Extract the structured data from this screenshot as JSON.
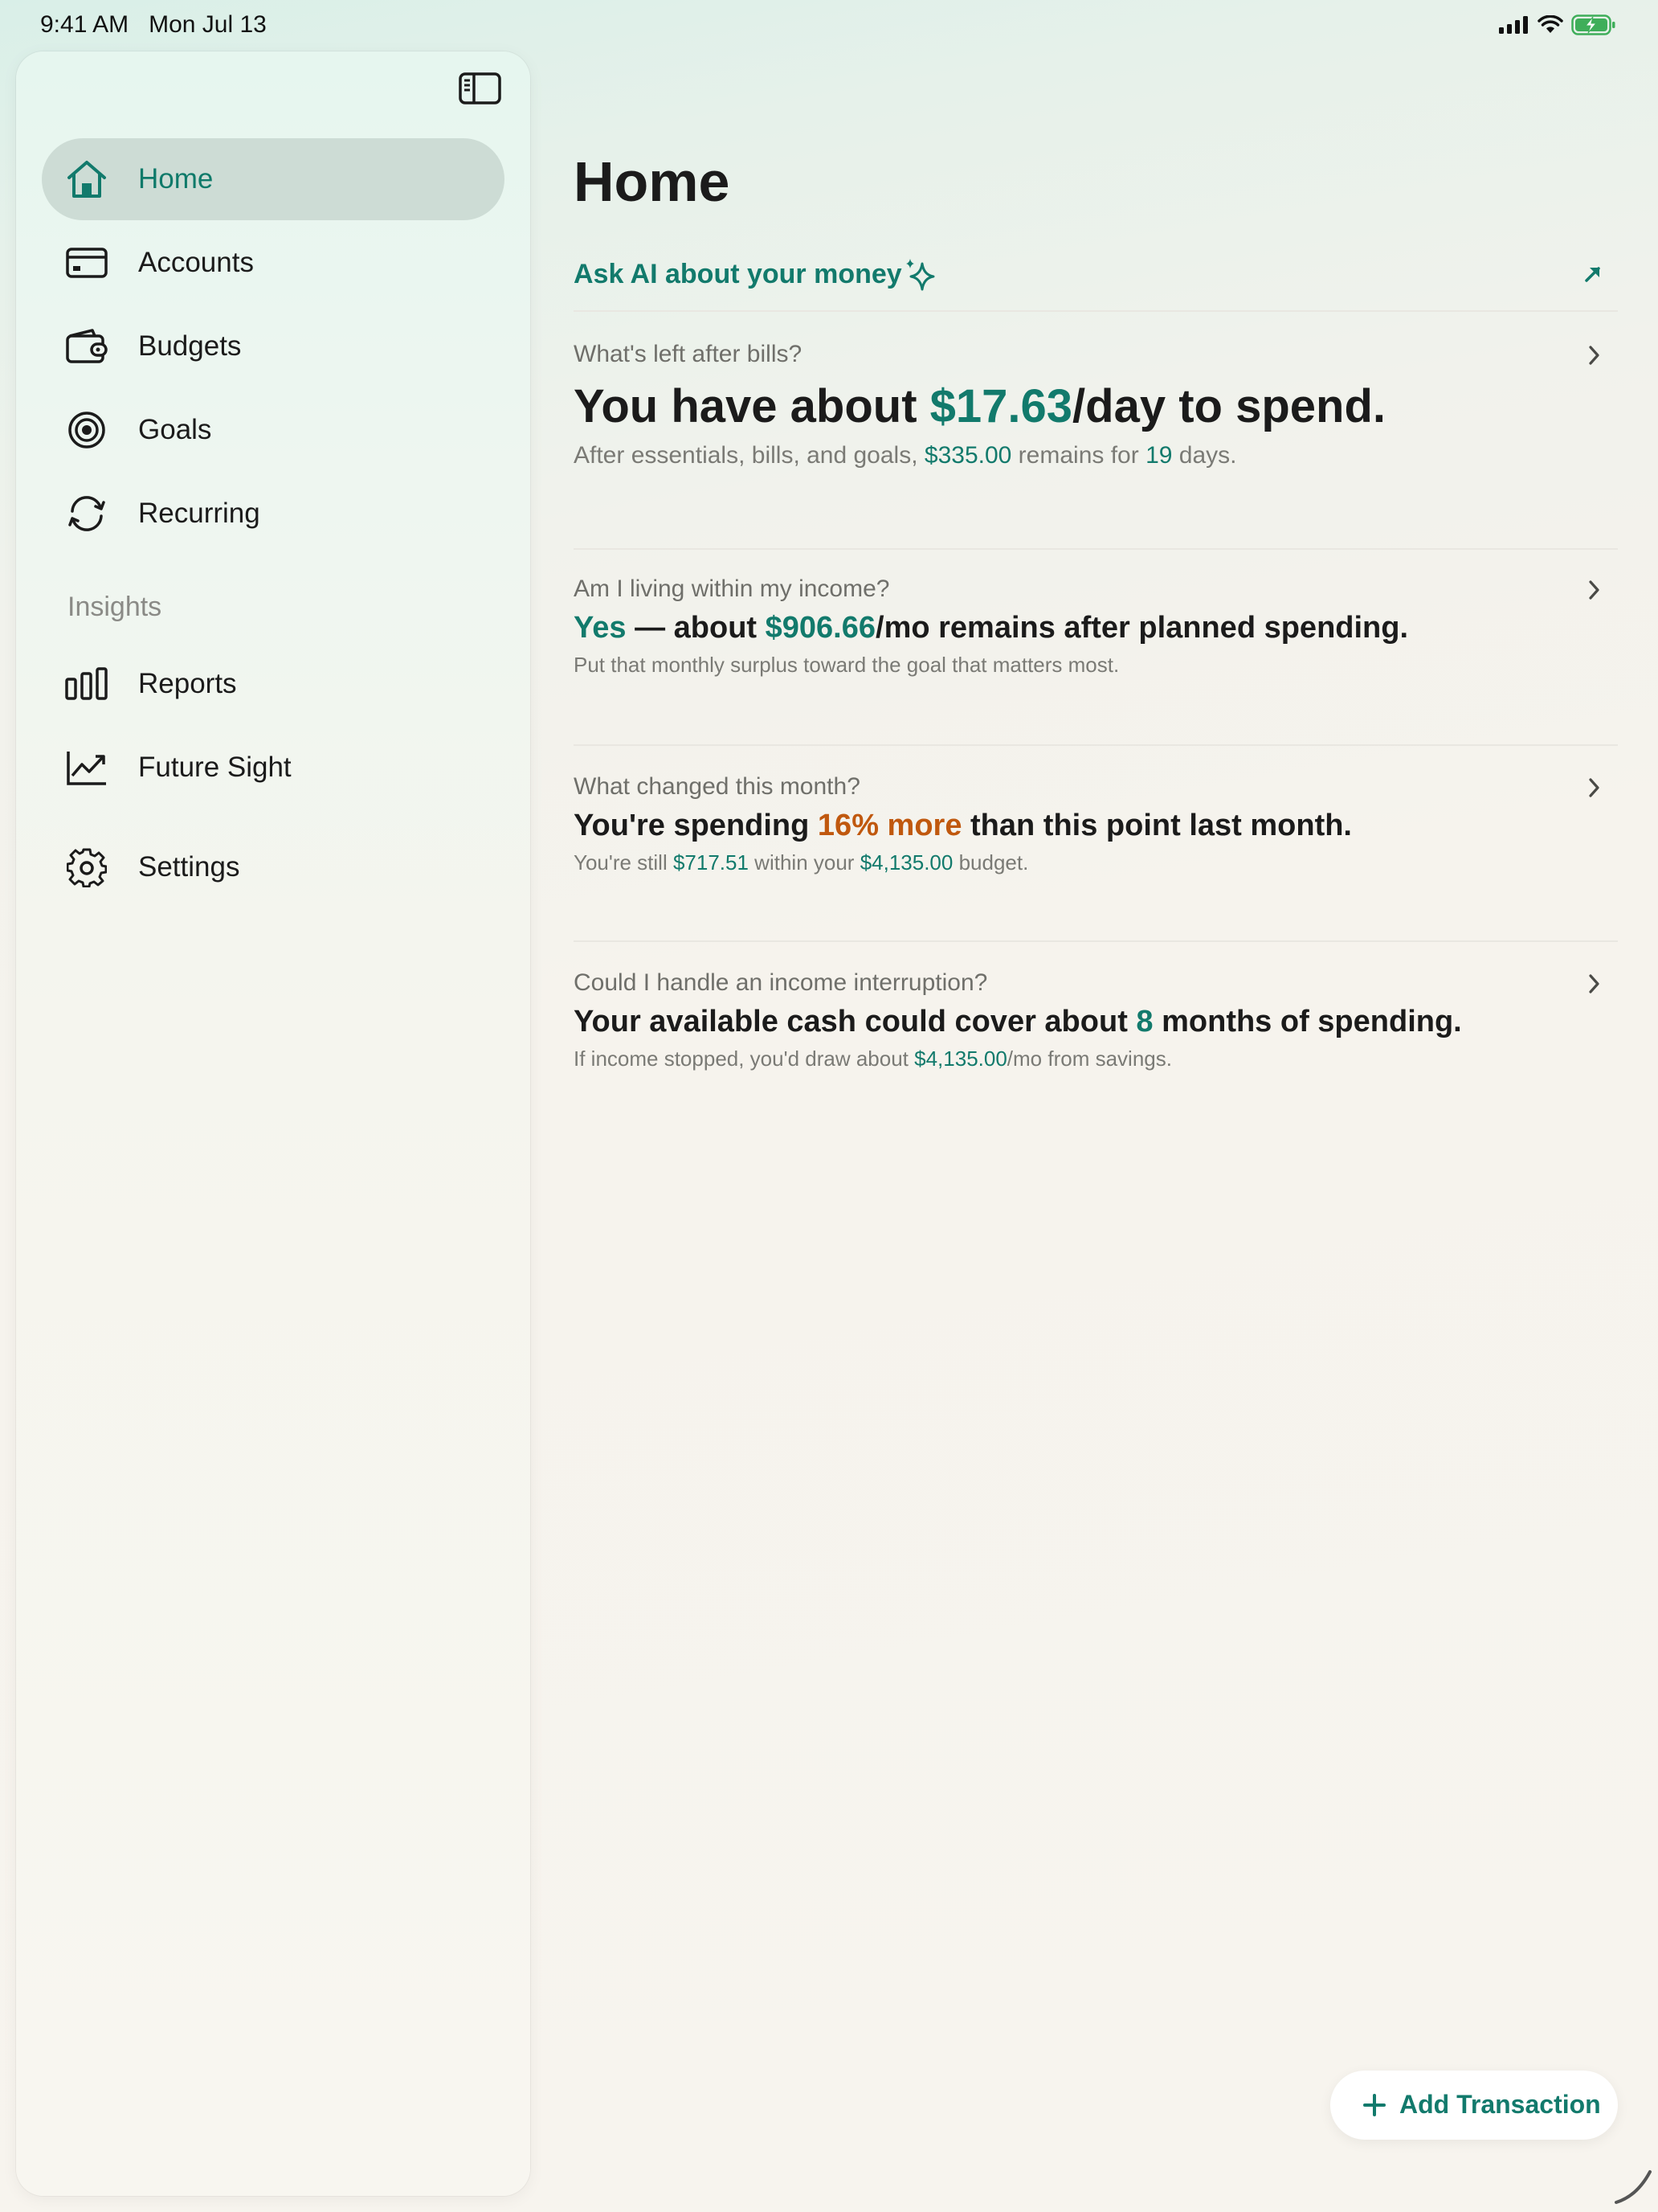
{
  "status_bar": {
    "time": "9:41 AM",
    "date": "Mon Jul 13"
  },
  "sidebar": {
    "items": [
      {
        "label": "Home",
        "icon": "home-icon",
        "active": true
      },
      {
        "label": "Accounts",
        "icon": "credit-card-icon"
      },
      {
        "label": "Budgets",
        "icon": "wallet-icon"
      },
      {
        "label": "Goals",
        "icon": "target-icon"
      },
      {
        "label": "Recurring",
        "icon": "recurring-icon"
      }
    ],
    "section_label": "Insights",
    "insights_items": [
      {
        "label": "Reports",
        "icon": "bar-chart-icon"
      },
      {
        "label": "Future Sight",
        "icon": "trend-chart-icon"
      }
    ],
    "settings_label": "Settings"
  },
  "main": {
    "title": "Home",
    "ai_prompt": "Ask AI about your money",
    "cards": [
      {
        "question": "What's left after bills?",
        "headline": {
          "pre": "You have about ",
          "amount": "$17.63",
          "post": "/day to spend."
        },
        "sub": {
          "pre": "After essentials, bills, and goals, ",
          "amount": "$335.00",
          "mid": " remains for ",
          "days": "19",
          "post": " days."
        }
      },
      {
        "question": "Am I living within my income?",
        "headline": {
          "yes": "Yes",
          "pre": " — about ",
          "amount": "$906.66",
          "post": "/mo remains after planned spending."
        },
        "sub": "Put that monthly surplus toward the goal that matters most."
      },
      {
        "question": "What changed this month?",
        "headline": {
          "pre": "You're spending ",
          "highlight": "16% more",
          "post": " than this point last month."
        },
        "sub": {
          "pre": "You're still ",
          "amount1": "$717.51",
          "mid": " within your ",
          "amount2": "$4,135.00",
          "post": " budget."
        }
      },
      {
        "question": "Could I handle an income interruption?",
        "headline": {
          "pre": "Your available cash could cover about ",
          "months": "8",
          "post": " months of spending."
        },
        "sub": {
          "pre": "If income stopped, you'd draw about ",
          "amount": "$4,135.00",
          "post": "/mo from savings."
        }
      }
    ]
  },
  "add_transaction_label": "Add Transaction",
  "colors": {
    "accent": "#127a6c",
    "warning": "#c0580e",
    "active_nav_bg": "#cddcd5"
  }
}
